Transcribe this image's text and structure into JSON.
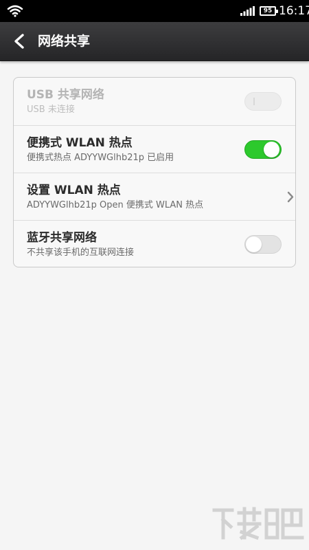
{
  "status_bar": {
    "wifi_icon": "wifi-icon",
    "signal_icon": "signal-bars-icon",
    "battery_level": "95",
    "time": "16:17"
  },
  "header": {
    "back_icon": "chevron-left-icon",
    "title": "网络共享"
  },
  "settings": {
    "items": [
      {
        "label": "USB 共享网络",
        "subtitle": "USB 未连接",
        "control": "toggle",
        "state": "disabled"
      },
      {
        "label": "便携式 WLAN 热点",
        "subtitle": "便携式热点 ADYYWGlhb21p 已启用",
        "control": "toggle",
        "state": "on"
      },
      {
        "label": "设置 WLAN 热点",
        "subtitle": "ADYYWGlhb21p Open 便携式 WLAN 热点",
        "control": "chevron-right-icon"
      },
      {
        "label": "蓝牙共享网络",
        "subtitle": "不共享该手机的互联网连接",
        "control": "toggle",
        "state": "off"
      }
    ]
  },
  "colors": {
    "toggle_on": "#2dc92d",
    "header_bg": "#2f2f31",
    "page_bg": "#f5f5f5"
  }
}
